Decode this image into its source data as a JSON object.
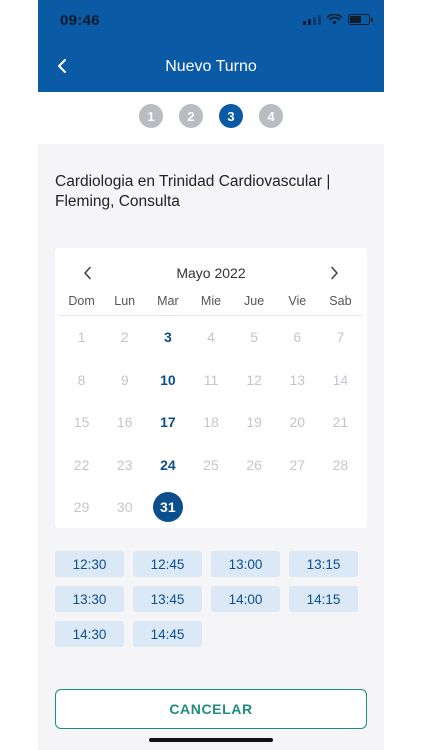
{
  "status_bar": {
    "time": "09:46"
  },
  "header": {
    "title": "Nuevo Turno",
    "back_icon": "chevron-left-icon"
  },
  "stepper": {
    "steps": [
      "1",
      "2",
      "3",
      "4"
    ],
    "active_index": 2
  },
  "specialty": {
    "text": "Cardiologia en Trinidad Cardiovascular | Fleming, Consulta"
  },
  "calendar": {
    "month_label": "Mayo 2022",
    "weekdays": [
      "Dom",
      "Lun",
      "Mar",
      "Mie",
      "Jue",
      "Vie",
      "Sab"
    ],
    "days": [
      {
        "d": "1",
        "state": "disabled"
      },
      {
        "d": "2",
        "state": "disabled"
      },
      {
        "d": "3",
        "state": "available"
      },
      {
        "d": "4",
        "state": "disabled"
      },
      {
        "d": "5",
        "state": "disabled"
      },
      {
        "d": "6",
        "state": "disabled"
      },
      {
        "d": "7",
        "state": "disabled"
      },
      {
        "d": "8",
        "state": "disabled"
      },
      {
        "d": "9",
        "state": "disabled"
      },
      {
        "d": "10",
        "state": "available"
      },
      {
        "d": "11",
        "state": "disabled"
      },
      {
        "d": "12",
        "state": "disabled"
      },
      {
        "d": "13",
        "state": "disabled"
      },
      {
        "d": "14",
        "state": "disabled"
      },
      {
        "d": "15",
        "state": "disabled"
      },
      {
        "d": "16",
        "state": "disabled"
      },
      {
        "d": "17",
        "state": "available"
      },
      {
        "d": "18",
        "state": "disabled"
      },
      {
        "d": "19",
        "state": "disabled"
      },
      {
        "d": "20",
        "state": "disabled"
      },
      {
        "d": "21",
        "state": "disabled"
      },
      {
        "d": "22",
        "state": "disabled"
      },
      {
        "d": "23",
        "state": "disabled"
      },
      {
        "d": "24",
        "state": "available"
      },
      {
        "d": "25",
        "state": "disabled"
      },
      {
        "d": "26",
        "state": "disabled"
      },
      {
        "d": "27",
        "state": "disabled"
      },
      {
        "d": "28",
        "state": "disabled"
      },
      {
        "d": "29",
        "state": "disabled"
      },
      {
        "d": "30",
        "state": "disabled"
      },
      {
        "d": "31",
        "state": "selected"
      }
    ]
  },
  "time_slots": [
    "12:30",
    "12:45",
    "13:00",
    "13:15",
    "13:30",
    "13:45",
    "14:00",
    "14:15",
    "14:30",
    "14:45"
  ],
  "cancel_label": "CANCELAR",
  "colors": {
    "primary": "#0b5aa6",
    "accent": "#1f8d7e",
    "slot_bg": "#dbe8f6",
    "disabled": "#c2c6cc"
  }
}
